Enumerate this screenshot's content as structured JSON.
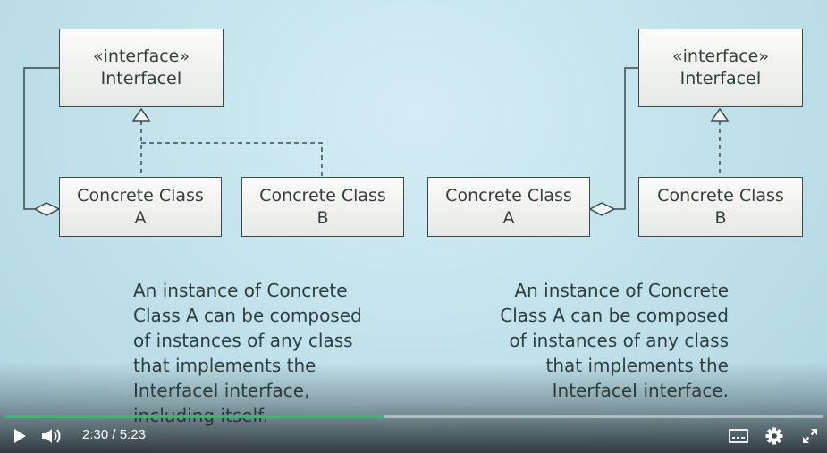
{
  "slide": {
    "left_diagram": {
      "interface_box": {
        "stereotype": "«interface»",
        "name": "InterfaceI"
      },
      "class_a": {
        "line1": "Concrete Class",
        "line2": "A"
      },
      "class_b": {
        "line1": "Concrete Class",
        "line2": "B"
      }
    },
    "right_diagram": {
      "interface_box": {
        "stereotype": "«interface»",
        "name": "InterfaceI"
      },
      "class_a": {
        "line1": "Concrete Class",
        "line2": "A"
      },
      "class_b": {
        "line1": "Concrete Class",
        "line2": "B"
      }
    },
    "left_caption": "An instance of Concrete\nClass A can be composed\nof instances of any class\nthat implements the\nInterfaceI interface,\nincluding itself.",
    "right_caption": "An instance of Concrete\nClass A can be composed\nof instances of any class\nthat implements the\nInterfaceI interface."
  },
  "player": {
    "current_time": "2:30",
    "separator": " / ",
    "duration": "5:23",
    "progress_fraction": 0.464,
    "icons": [
      "play-icon",
      "volume-icon",
      "captions-icon",
      "settings-icon",
      "fullscreen-icon"
    ],
    "colors": {
      "progress": "#2fbf6a",
      "controls": "#ffffff"
    }
  }
}
